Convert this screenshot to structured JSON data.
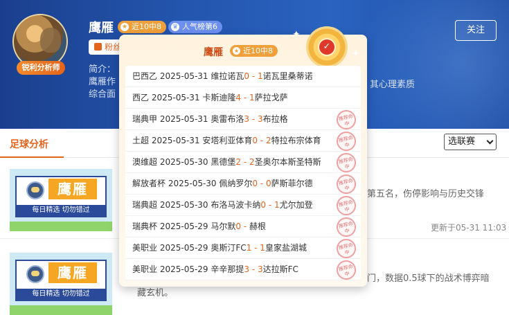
{
  "expert": {
    "name": "鹰雁",
    "avatar_tag": "锐利分析师",
    "badge_streak": "近10中8",
    "badge_rank": "人气榜第6",
    "follow_label": "关注",
    "fans_label": "粉丝",
    "intro_label": "简介：",
    "intro_line2": "鹰雁作",
    "intro_line3": "综合面",
    "intro_right": "其心理素质"
  },
  "tabs": {
    "active": "足球分析",
    "league_select": "选联赛"
  },
  "articles": [
    {
      "thumb_brand": "鹰雁",
      "thumb_slogan": "每日精选  切勿错过",
      "text": "第五名，伤停影响与历史交锋",
      "time": "更新于05-31 11:03"
    },
    {
      "thumb_brand": "鹰雁",
      "thumb_slogan": "每日精选  切勿错过",
      "text_line1": "门，数据0.5球下的战术博弈暗",
      "text_line2": "藏玄机。"
    }
  ],
  "popup": {
    "name": "鹰雁",
    "badge": "近10中8",
    "stamp_text": "推荐命中",
    "records": [
      {
        "league": "巴西乙",
        "date": "2025-05-31",
        "home": "维拉诺瓦",
        "hs": "0",
        "as": "1",
        "away": "诺瓦里桑蒂诺",
        "hit": false
      },
      {
        "league": "西乙",
        "date": "2025-05-31",
        "home": "卡斯迪隆",
        "hs": "4",
        "as": "1",
        "away": "萨拉戈萨",
        "hit": false
      },
      {
        "league": "瑞典甲",
        "date": "2025-05-31",
        "home": "奥雷布洛",
        "hs": "3",
        "as": "3",
        "away": "布拉格",
        "hit": true
      },
      {
        "league": "土超",
        "date": "2025-05-31",
        "home": "安塔利亚体育",
        "hs": "0",
        "as": "2",
        "away": "特拉布宗体育",
        "hit": true
      },
      {
        "league": "澳维超",
        "date": "2025-05-30",
        "home": "黑德堡",
        "hs": "2",
        "as": "2",
        "away": "圣奥尔本斯圣特斯",
        "hit": true
      },
      {
        "league": "解放者杯",
        "date": "2025-05-30",
        "home": "佩纳罗尔",
        "hs": "0",
        "as": "0",
        "away": "萨斯菲尔德",
        "hit": true
      },
      {
        "league": "瑞典超",
        "date": "2025-05-30",
        "home": "布洛马波卡纳",
        "hs": "0",
        "as": "1",
        "away": "尤尔加登",
        "hit": true
      },
      {
        "league": "瑞典杯",
        "date": "2025-05-29",
        "home": "马尔默",
        "hs": "0",
        "as": "",
        "away": "赫根",
        "hit": true
      },
      {
        "league": "美职业",
        "date": "2025-05-29",
        "home": "奥斯汀FC",
        "hs": "1",
        "as": "1",
        "away": "皇家盐湖城",
        "hit": true
      },
      {
        "league": "美职业",
        "date": "2025-05-29",
        "home": "辛辛那提",
        "hs": "3",
        "as": "3",
        "away": "达拉斯FC",
        "hit": true
      }
    ]
  },
  "colors": {
    "accent": "#e4641b",
    "banner": "#2355ad",
    "badge_gold": "#f0a03a",
    "badge_blue": "#6d8ff0"
  }
}
